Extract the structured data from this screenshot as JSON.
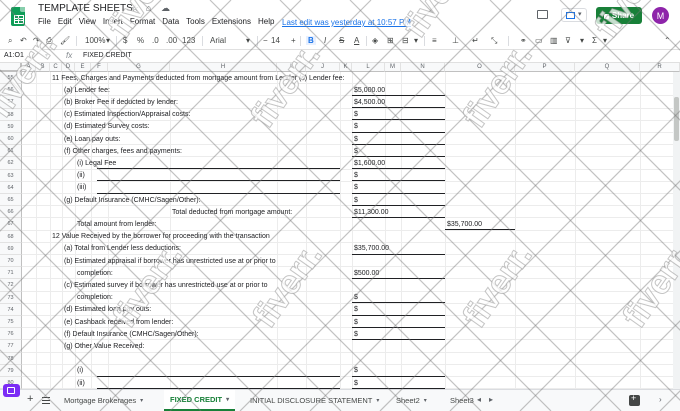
{
  "app": {
    "title": "TEMPLATE SHEETS",
    "menu": [
      "File",
      "Edit",
      "View",
      "Insert",
      "Format",
      "Data",
      "Tools",
      "Extensions",
      "Help"
    ],
    "last_edit": "Last edit was yesterday at 10:57 PM",
    "share_label": "Share",
    "avatar_initial": "M",
    "title_icons": [
      "star-icon",
      "move-icon",
      "cloud-status-icon"
    ]
  },
  "toolbar": {
    "zoom": "100%",
    "currency": "$",
    "percent": "%",
    "dec_decrease": ".0",
    "dec_increase": ".00",
    "number_format": "123",
    "font_family": "Arial",
    "font_size": "14",
    "bold": "B",
    "italic": "I",
    "strike": "S",
    "text_color": "A"
  },
  "formula_bar": {
    "name_box": "A1:O1",
    "fx": "fx",
    "content": "FIXED CREDIT"
  },
  "columns": [
    "A",
    "B",
    "C",
    "D",
    "E",
    "F",
    "G",
    "H",
    "I",
    "J",
    "K",
    "L",
    "M",
    "N",
    "O",
    "P",
    "Q",
    "R"
  ],
  "rows": [
    {
      "num": "55",
      "cells": [
        {
          "col": "C",
          "text": "11  Fees, Charges and Payments deducted from mortgage amount from Lender (s) Lender fee:"
        }
      ]
    },
    {
      "num": "56",
      "cells": [
        {
          "col": "D",
          "text": "(a) Lender fee:"
        },
        {
          "col": "L",
          "text": "$5,000.00",
          "underline": true
        }
      ]
    },
    {
      "num": "57",
      "cells": [
        {
          "col": "D",
          "text": "(b) Broker Fee if deducted by lender:"
        },
        {
          "col": "L",
          "text": "$4,500.00",
          "underline": true
        }
      ]
    },
    {
      "num": "58",
      "cells": [
        {
          "col": "D",
          "text": "(c) Estimated Inspection/Appraisal costs:"
        },
        {
          "col": "L",
          "text": "$",
          "underline": true
        }
      ]
    },
    {
      "num": "59",
      "cells": [
        {
          "col": "D",
          "text": "(d) Estimated Survey costs:"
        },
        {
          "col": "L",
          "text": "$",
          "underline": true
        }
      ]
    },
    {
      "num": "60",
      "cells": [
        {
          "col": "D",
          "text": "(e) Loan pay outs:"
        },
        {
          "col": "L",
          "text": "$",
          "underline": true
        }
      ]
    },
    {
      "num": "61",
      "cells": [
        {
          "col": "D",
          "text": "(f) Other charges, fees and payments:"
        },
        {
          "col": "L",
          "text": "$",
          "underline": true
        }
      ]
    },
    {
      "num": "62",
      "cells": [
        {
          "col": "E",
          "text": "(i)    Legal Fee",
          "underline": "long"
        },
        {
          "col": "L",
          "text": "$1,600.00",
          "underline": true
        }
      ]
    },
    {
      "num": "63",
      "cells": [
        {
          "col": "E",
          "text": "(ii)",
          "underline": "long"
        },
        {
          "col": "L",
          "text": "$",
          "underline": true
        }
      ]
    },
    {
      "num": "64",
      "cells": [
        {
          "col": "E",
          "text": "(iii)",
          "underline": "long"
        },
        {
          "col": "L",
          "text": "$",
          "underline": true
        }
      ]
    },
    {
      "num": "65",
      "cells": [
        {
          "col": "D",
          "text": "(g)   Default Insurance (CMHC/Sagen/Other):"
        },
        {
          "col": "L",
          "text": "$",
          "underline": true
        }
      ]
    },
    {
      "num": "66",
      "cells": [
        {
          "col": "H",
          "text": "Total deducted from mortgage amount:"
        },
        {
          "col": "L",
          "text": "$11,300.00",
          "underline": true
        }
      ]
    },
    {
      "num": "67",
      "cells": [
        {
          "col": "E",
          "text": "Total amount from lender:"
        },
        {
          "col": "O",
          "text": "$35,700.00",
          "underline": true
        }
      ]
    },
    {
      "num": "68",
      "cells": [
        {
          "col": "C",
          "text": "12  Value Received by the borrower for proceeding with the transaction"
        }
      ]
    },
    {
      "num": "69",
      "cells": [
        {
          "col": "D",
          "text": "(a)   Total from Lender less deductions:"
        },
        {
          "col": "L",
          "text": "$35,700.00",
          "underline": true
        }
      ]
    },
    {
      "num": "70",
      "cells": [
        {
          "col": "D",
          "text": "(b)   Estimated appraisal if borrower has unrestricted use at or prior to"
        }
      ]
    },
    {
      "num": "71",
      "cells": [
        {
          "col": "E",
          "text": "completion:"
        },
        {
          "col": "L",
          "text": "$500.00",
          "underline": true
        }
      ]
    },
    {
      "num": "72",
      "cells": [
        {
          "col": "D",
          "text": "(c)   Estimated survey if borrower has unrestricted use at or prior to"
        }
      ]
    },
    {
      "num": "73",
      "cells": [
        {
          "col": "E",
          "text": "completion:"
        },
        {
          "col": "L",
          "text": "$",
          "underline": true
        }
      ]
    },
    {
      "num": "74",
      "cells": [
        {
          "col": "D",
          "text": "(d)   Estimated loan pay outs:"
        },
        {
          "col": "L",
          "text": "$",
          "underline": true
        }
      ]
    },
    {
      "num": "75",
      "cells": [
        {
          "col": "D",
          "text": "(e)   Cashback received from lender:"
        },
        {
          "col": "L",
          "text": "$",
          "underline": true
        }
      ]
    },
    {
      "num": "76",
      "cells": [
        {
          "col": "D",
          "text": "(f)   Default Insurance (CMHC/Sagen/Other):"
        },
        {
          "col": "L",
          "text": "$",
          "underline": true
        }
      ]
    },
    {
      "num": "77",
      "cells": [
        {
          "col": "D",
          "text": "(g)   Other Value Received:"
        }
      ]
    },
    {
      "num": "78",
      "cells": []
    },
    {
      "num": "79",
      "cells": [
        {
          "col": "E",
          "text": "(i)",
          "underline": "long"
        },
        {
          "col": "L",
          "text": "$",
          "underline": true
        }
      ]
    },
    {
      "num": "80",
      "cells": [
        {
          "col": "E",
          "text": "(ii)",
          "underline": "long"
        },
        {
          "col": "L",
          "text": "$",
          "underline": true
        }
      ]
    }
  ],
  "sheet_tabs": [
    {
      "label": "Mortgage Brokerages",
      "active": false
    },
    {
      "label": "FIXED CREDIT",
      "active": true
    },
    {
      "label": "INITIAL DISCLOSURE STATEMENT",
      "active": false
    },
    {
      "label": "Sheet2",
      "active": false
    },
    {
      "label": "Sheet3",
      "active": false
    }
  ],
  "watermark_text": "fiverr.",
  "colors": {
    "accent": "#188038",
    "share": "#188038",
    "link": "#1a73e8",
    "avatar": "#8e24aa"
  }
}
